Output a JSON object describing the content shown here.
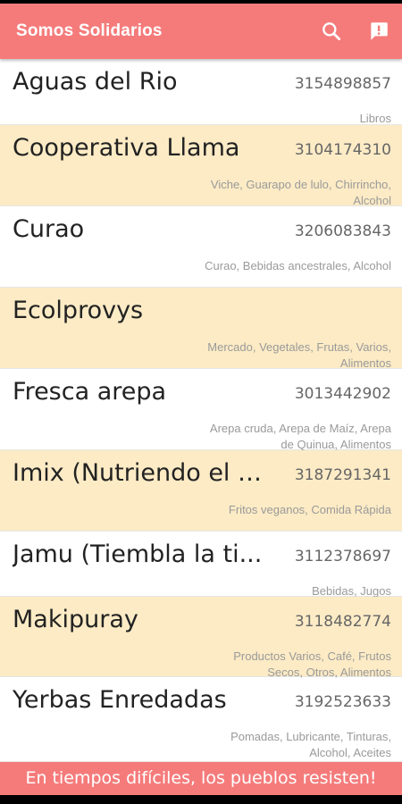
{
  "appbar": {
    "title": "Somos Solidarios",
    "search_icon": "search-icon",
    "report_icon": "feedback-icon"
  },
  "items": [
    {
      "name": "Aguas del Rio",
      "phone": "3154898857",
      "tags": "Libros"
    },
    {
      "name": "Cooperativa Llama",
      "phone": "3104174310",
      "tags": "Viche, Guarapo de lulo, Chirrincho, Alcohol"
    },
    {
      "name": "Curao",
      "phone": "3206083843",
      "tags": "Curao, Bebidas ancestrales, Alcohol"
    },
    {
      "name": "Ecolprovys",
      "phone": "",
      "tags": "Mercado, Vegetales, Frutas, Varios, Alimentos"
    },
    {
      "name": "Fresca arepa",
      "phone": "3013442902",
      "tags": "Arepa cruda, Arepa de Maíz, Arepa de Quinua, Alimentos"
    },
    {
      "name": "Imix (Nutriendo el S...",
      "phone": "3187291341",
      "tags": "Fritos veganos, Comida Rápida"
    },
    {
      "name": "Jamu (Tiembla la ti...",
      "phone": "3112378697",
      "tags": "Bebidas, Jugos"
    },
    {
      "name": "Makipuray",
      "phone": "3118482774",
      "tags": "Productos Varios, Café, Frutos Secos, Otros, Alimentos"
    },
    {
      "name": "Yerbas Enredadas",
      "phone": "3192523633",
      "tags": "Pomadas, Lubricante, Tinturas, Alcohol, Aceites"
    }
  ],
  "footer": {
    "text": "En tiempos difíciles, los pueblos resisten!"
  },
  "colors": {
    "accent": "#f57b7b",
    "alt_row": "#fcebc5"
  }
}
